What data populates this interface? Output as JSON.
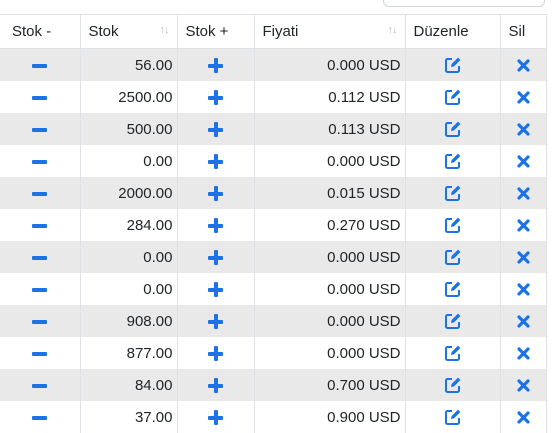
{
  "columns": {
    "stock_minus": "Stok -",
    "stock": "Stok",
    "stock_plus": "Stok +",
    "price": "Fiyati",
    "edit": "Düzenle",
    "delete": "Sil"
  },
  "icons": {
    "sort": "sort-icon",
    "minus": "minus-icon",
    "plus": "plus-icon",
    "edit": "edit-icon",
    "delete": "close-icon"
  },
  "colors": {
    "accent": "#1a73e8",
    "stripe": "#e9e9e9",
    "border": "#dee2e6"
  },
  "rows": [
    {
      "stock": "56.00",
      "price": "0.000 USD"
    },
    {
      "stock": "2500.00",
      "price": "0.112 USD"
    },
    {
      "stock": "500.00",
      "price": "0.113 USD"
    },
    {
      "stock": "0.00",
      "price": "0.000 USD"
    },
    {
      "stock": "2000.00",
      "price": "0.015 USD"
    },
    {
      "stock": "284.00",
      "price": "0.270 USD"
    },
    {
      "stock": "0.00",
      "price": "0.000 USD"
    },
    {
      "stock": "0.00",
      "price": "0.000 USD"
    },
    {
      "stock": "908.00",
      "price": "0.000 USD"
    },
    {
      "stock": "877.00",
      "price": "0.000 USD"
    },
    {
      "stock": "84.00",
      "price": "0.700 USD"
    },
    {
      "stock": "37.00",
      "price": "0.900 USD"
    }
  ]
}
